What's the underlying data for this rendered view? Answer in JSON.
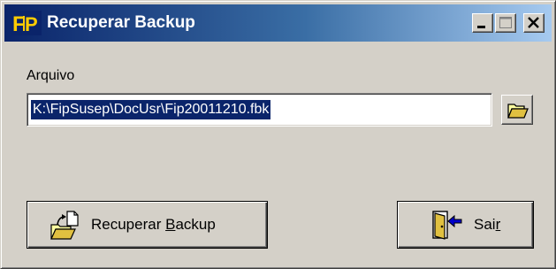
{
  "window": {
    "title": "Recuperar Backup",
    "logo_text": "FiP",
    "controls": {
      "minimize": "minimize-icon",
      "maximize": "maximize-icon",
      "close": "close-icon"
    }
  },
  "form": {
    "file_label": "Arquivo",
    "file_value": "K:\\FipSusep\\DocUsr\\Fip20011210.fbk",
    "browse_icon": "folder-open-icon"
  },
  "buttons": {
    "restore": {
      "label_pre": "Recuperar ",
      "label_key": "B",
      "label_post": "ackup",
      "icon": "restore-backup-icon"
    },
    "exit": {
      "label_pre": "Sai",
      "label_key": "r",
      "label_post": "",
      "icon": "exit-door-icon"
    }
  },
  "colors": {
    "face": "#d4d0c8",
    "title_start": "#0a246a",
    "title_end": "#a6caf0",
    "selection": "#0a246a"
  }
}
